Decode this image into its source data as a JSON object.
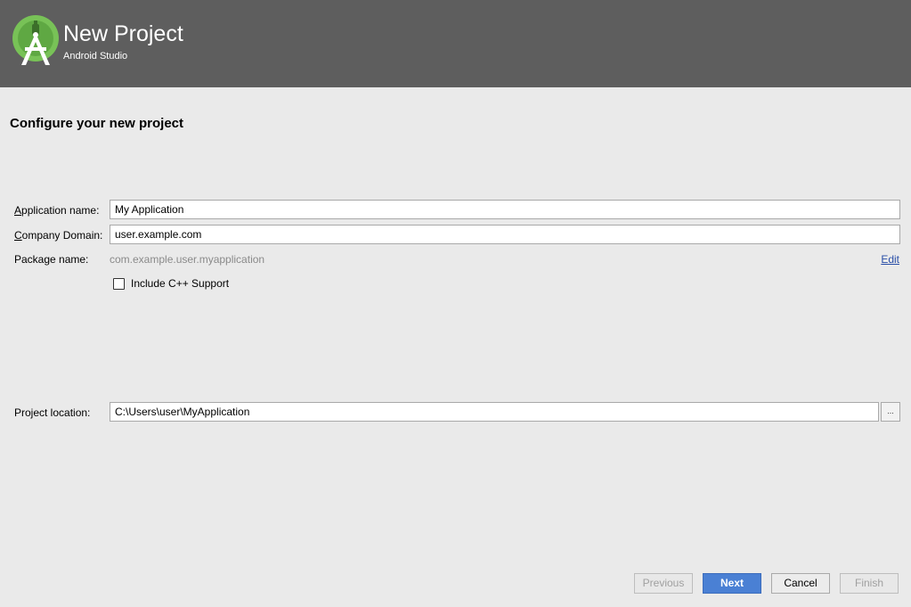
{
  "header": {
    "title": "New Project",
    "subtitle": "Android Studio",
    "logo_icon": "android-studio-logo-icon",
    "background_color": "#5e5e5e",
    "logo_color": "#78c257"
  },
  "page": {
    "title": "Configure your new project"
  },
  "form": {
    "app_name": {
      "label_accel": "A",
      "label_rest": "pplication name:",
      "value": "My Application"
    },
    "company_domain": {
      "label_accel": "C",
      "label_rest": "ompany Domain:",
      "value": "user.example.com"
    },
    "package_name": {
      "label": "Package name:",
      "value": "com.example.user.myapplication",
      "edit_label": "Edit"
    },
    "cpp_support": {
      "label": "Include C++ Support",
      "checked": false
    },
    "project_location": {
      "label": "Project location:",
      "value": "C:\\Users\\user\\MyApplication",
      "browse_label": "..."
    }
  },
  "buttons": {
    "previous": "Previous",
    "next": "Next",
    "cancel": "Cancel",
    "finish": "Finish",
    "primary_color": "#4a80d4"
  }
}
